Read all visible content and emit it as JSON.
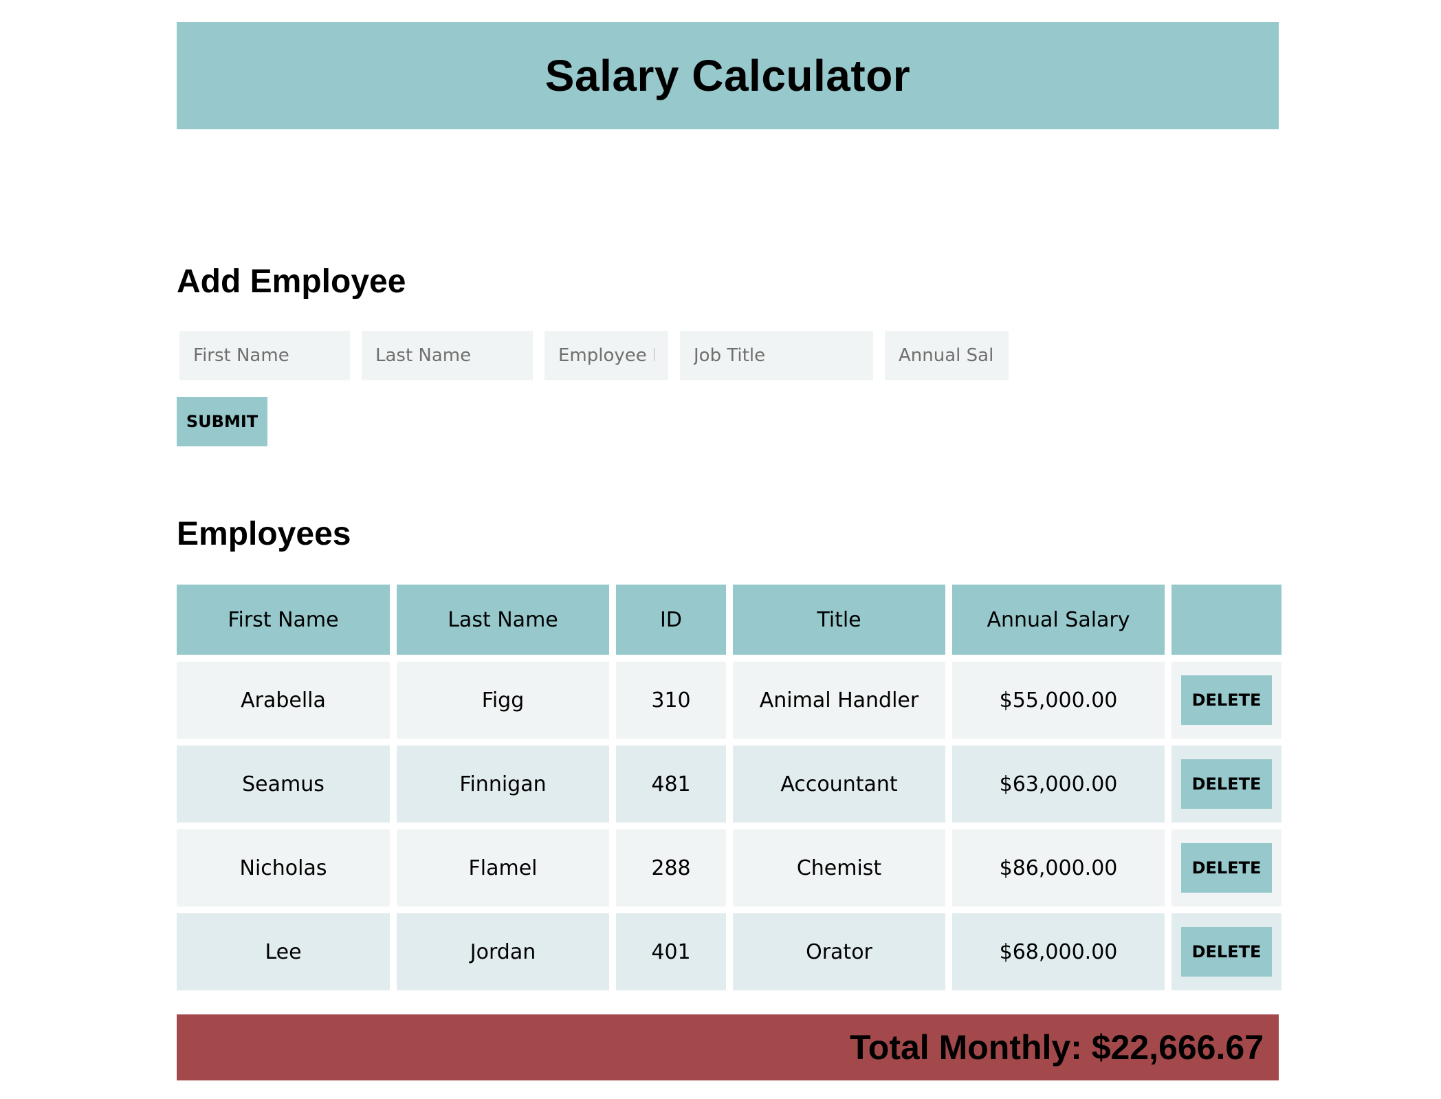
{
  "header": {
    "title": "Salary Calculator"
  },
  "add_employee": {
    "heading": "Add Employee",
    "fields": [
      {
        "placeholder": "First Name",
        "value": ""
      },
      {
        "placeholder": "Last Name",
        "value": ""
      },
      {
        "placeholder": "Employee ID",
        "value": ""
      },
      {
        "placeholder": "Job Title",
        "value": ""
      },
      {
        "placeholder": "Annual Salary",
        "value": ""
      }
    ],
    "submit_label": "SUBMIT"
  },
  "employees": {
    "heading": "Employees",
    "columns": [
      "First Name",
      "Last Name",
      "ID",
      "Title",
      "Annual Salary",
      ""
    ],
    "rows": [
      {
        "first": "Arabella",
        "last": "Figg",
        "id": "310",
        "title": "Animal Handler",
        "salary": "$55,000.00",
        "action": "DELETE"
      },
      {
        "first": "Seamus",
        "last": "Finnigan",
        "id": "481",
        "title": "Accountant",
        "salary": "$63,000.00",
        "action": "DELETE"
      },
      {
        "first": "Nicholas",
        "last": "Flamel",
        "id": "288",
        "title": "Chemist",
        "salary": "$86,000.00",
        "action": "DELETE"
      },
      {
        "first": "Lee",
        "last": "Jordan",
        "id": "401",
        "title": "Orator",
        "salary": "$68,000.00",
        "action": "DELETE"
      }
    ]
  },
  "total": {
    "text": "Total Monthly: $22,666.67"
  },
  "colors": {
    "accent": "#96c8cc",
    "row_light": "#f1f4f4",
    "row_alt": "#e1ecee",
    "total_bar": "#a3494b"
  }
}
